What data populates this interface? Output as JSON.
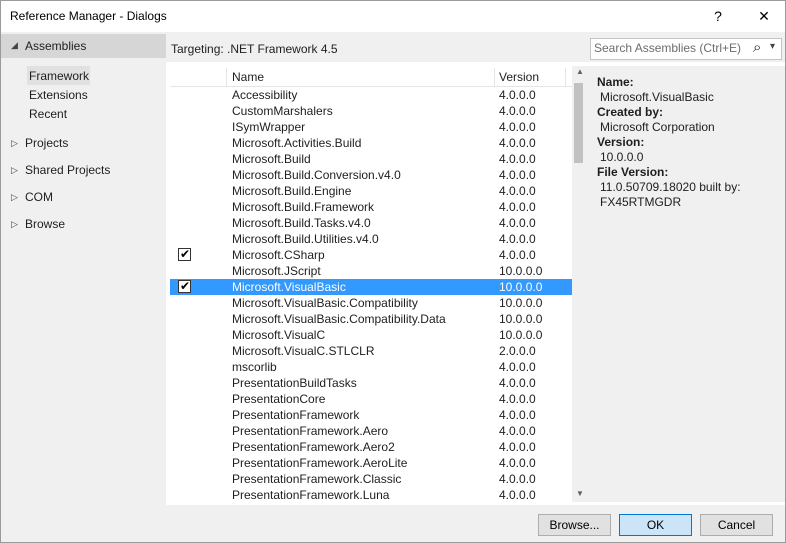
{
  "window": {
    "title": "Reference Manager - Dialogs",
    "help_glyph": "?",
    "close_glyph": "✕"
  },
  "sidebar": {
    "header": "Assemblies",
    "sub_items": [
      "Framework",
      "Extensions",
      "Recent"
    ],
    "groups": [
      "Projects",
      "Shared Projects",
      "COM",
      "Browse"
    ],
    "expanded_glyph": "◢",
    "collapsed_glyph": "▷"
  },
  "targeting": "Targeting: .NET Framework 4.5",
  "search": {
    "placeholder": "Search Assemblies (Ctrl+E)",
    "icon_glyph": "⌕",
    "dropdown_glyph": "▾"
  },
  "grid": {
    "columns": {
      "name": "Name",
      "version": "Version"
    },
    "rows": [
      {
        "name": "Accessibility",
        "version": "4.0.0.0",
        "checked": false,
        "selected": false
      },
      {
        "name": "CustomMarshalers",
        "version": "4.0.0.0",
        "checked": false,
        "selected": false
      },
      {
        "name": "ISymWrapper",
        "version": "4.0.0.0",
        "checked": false,
        "selected": false
      },
      {
        "name": "Microsoft.Activities.Build",
        "version": "4.0.0.0",
        "checked": false,
        "selected": false
      },
      {
        "name": "Microsoft.Build",
        "version": "4.0.0.0",
        "checked": false,
        "selected": false
      },
      {
        "name": "Microsoft.Build.Conversion.v4.0",
        "version": "4.0.0.0",
        "checked": false,
        "selected": false
      },
      {
        "name": "Microsoft.Build.Engine",
        "version": "4.0.0.0",
        "checked": false,
        "selected": false
      },
      {
        "name": "Microsoft.Build.Framework",
        "version": "4.0.0.0",
        "checked": false,
        "selected": false
      },
      {
        "name": "Microsoft.Build.Tasks.v4.0",
        "version": "4.0.0.0",
        "checked": false,
        "selected": false
      },
      {
        "name": "Microsoft.Build.Utilities.v4.0",
        "version": "4.0.0.0",
        "checked": false,
        "selected": false
      },
      {
        "name": "Microsoft.CSharp",
        "version": "4.0.0.0",
        "checked": true,
        "selected": false
      },
      {
        "name": "Microsoft.JScript",
        "version": "10.0.0.0",
        "checked": false,
        "selected": false
      },
      {
        "name": "Microsoft.VisualBasic",
        "version": "10.0.0.0",
        "checked": true,
        "selected": true
      },
      {
        "name": "Microsoft.VisualBasic.Compatibility",
        "version": "10.0.0.0",
        "checked": false,
        "selected": false
      },
      {
        "name": "Microsoft.VisualBasic.Compatibility.Data",
        "version": "10.0.0.0",
        "checked": false,
        "selected": false
      },
      {
        "name": "Microsoft.VisualC",
        "version": "10.0.0.0",
        "checked": false,
        "selected": false
      },
      {
        "name": "Microsoft.VisualC.STLCLR",
        "version": "2.0.0.0",
        "checked": false,
        "selected": false
      },
      {
        "name": "mscorlib",
        "version": "4.0.0.0",
        "checked": false,
        "selected": false
      },
      {
        "name": "PresentationBuildTasks",
        "version": "4.0.0.0",
        "checked": false,
        "selected": false
      },
      {
        "name": "PresentationCore",
        "version": "4.0.0.0",
        "checked": false,
        "selected": false
      },
      {
        "name": "PresentationFramework",
        "version": "4.0.0.0",
        "checked": false,
        "selected": false
      },
      {
        "name": "PresentationFramework.Aero",
        "version": "4.0.0.0",
        "checked": false,
        "selected": false
      },
      {
        "name": "PresentationFramework.Aero2",
        "version": "4.0.0.0",
        "checked": false,
        "selected": false
      },
      {
        "name": "PresentationFramework.AeroLite",
        "version": "4.0.0.0",
        "checked": false,
        "selected": false
      },
      {
        "name": "PresentationFramework.Classic",
        "version": "4.0.0.0",
        "checked": false,
        "selected": false
      },
      {
        "name": "PresentationFramework.Luna",
        "version": "4.0.0.0",
        "checked": false,
        "selected": false
      }
    ],
    "checkmark_glyph": "✔",
    "scroll_up_glyph": "▲",
    "scroll_down_glyph": "▼"
  },
  "details": {
    "name_label": "Name:",
    "name_value": "Microsoft.VisualBasic",
    "created_label": "Created by:",
    "created_value": "Microsoft Corporation",
    "version_label": "Version:",
    "version_value": "10.0.0.0",
    "file_version_label": "File Version:",
    "file_version_line1": "11.0.50709.18020 built by:",
    "file_version_line2": "FX45RTMGDR"
  },
  "buttons": {
    "browse": "Browse...",
    "ok": "OK",
    "cancel": "Cancel"
  },
  "colors": {
    "selection": "#3399ff",
    "panel": "#f0f0f0",
    "ok_border": "#0078d7"
  }
}
